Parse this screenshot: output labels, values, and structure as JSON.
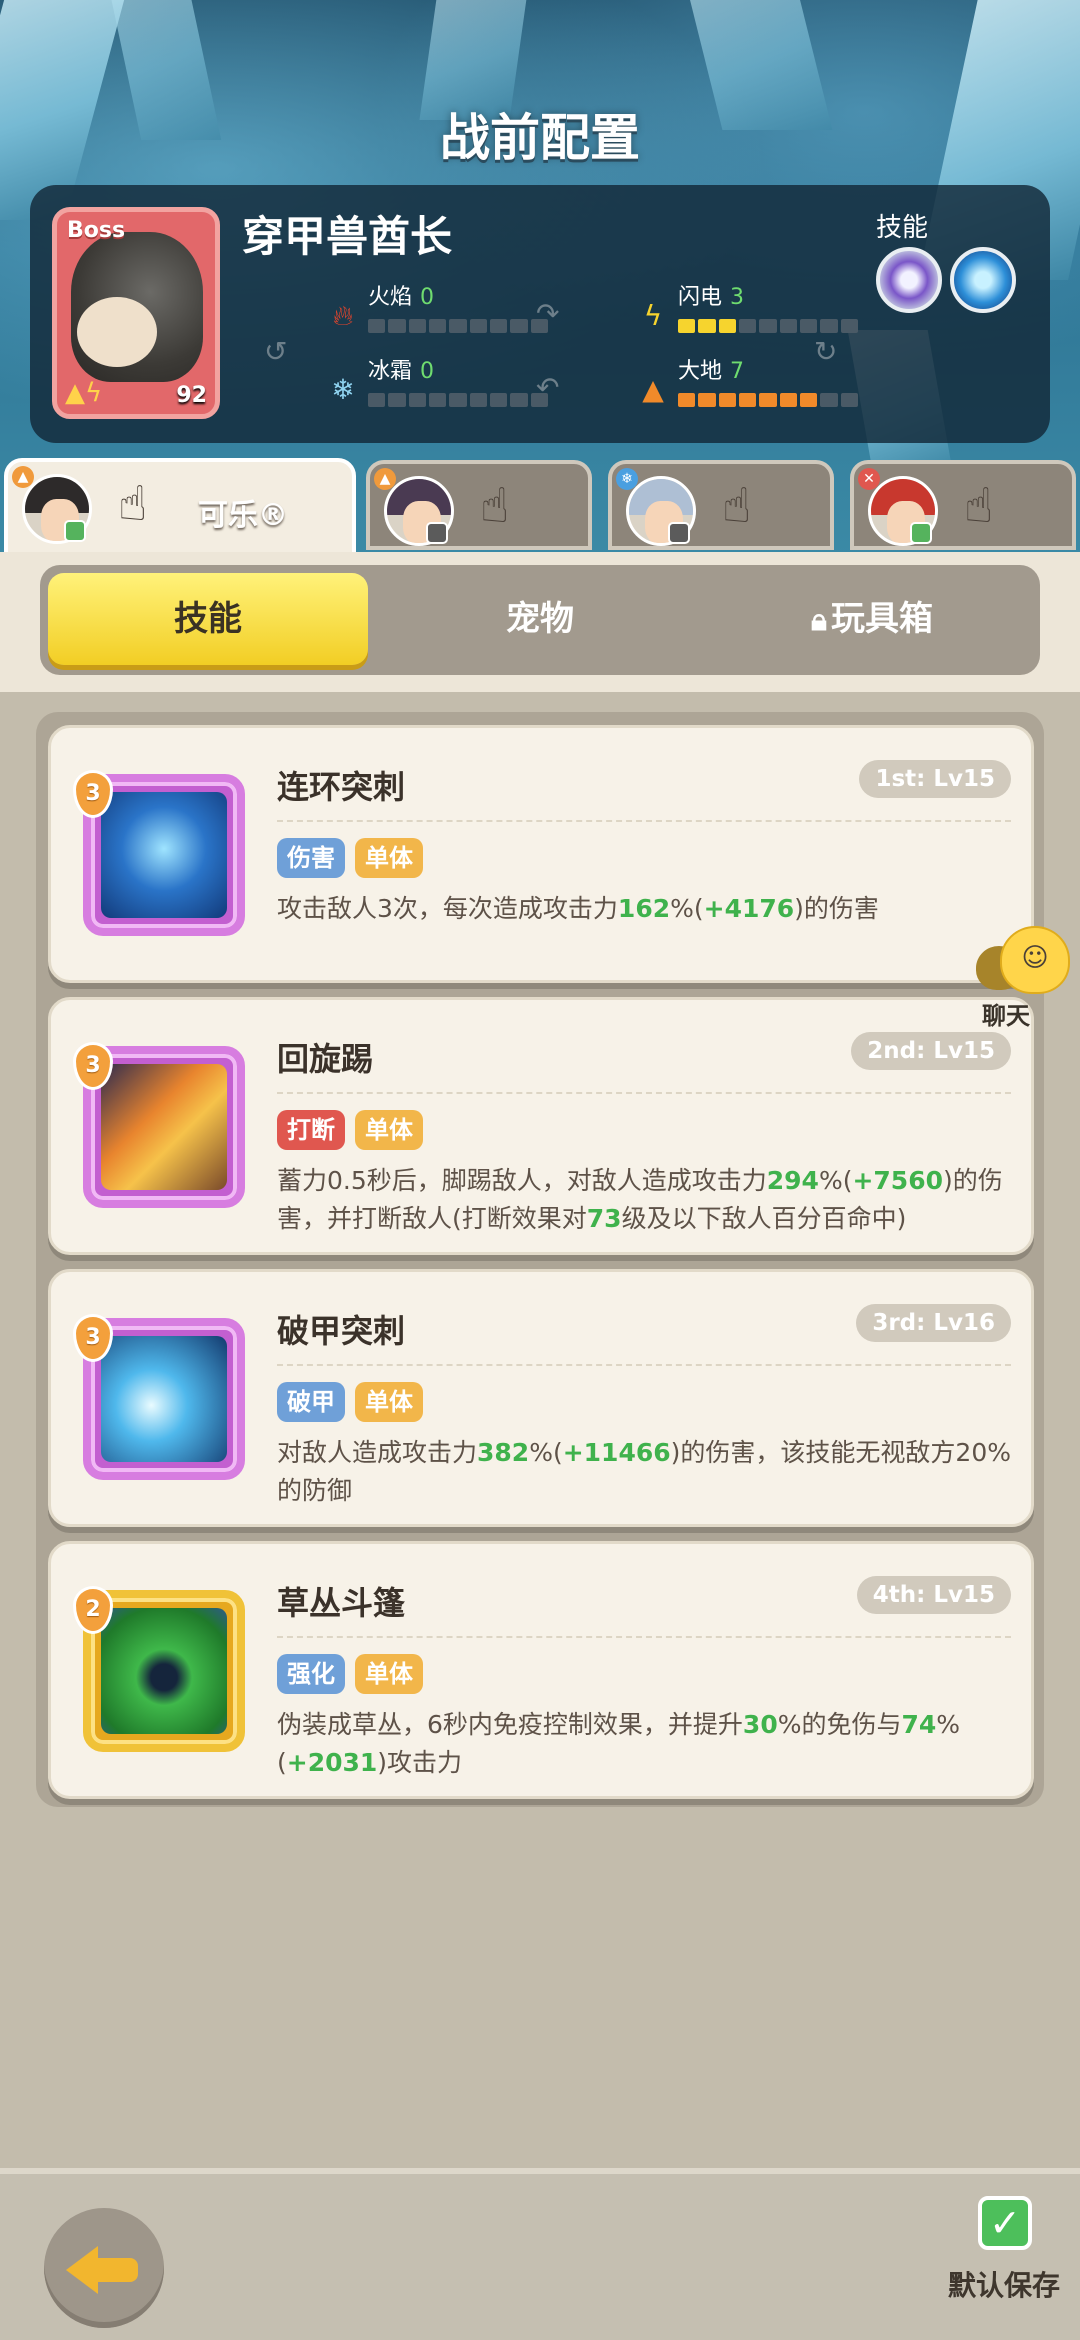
{
  "header": {
    "title": "战前配置"
  },
  "boss": {
    "tag": "Boss",
    "level": "92",
    "name": "穿甲兽酋长",
    "stats": [
      {
        "label": "火焰",
        "value": "0",
        "filled": 0,
        "total": 9,
        "color": "#f08a2a"
      },
      {
        "label": "闪电",
        "value": "3",
        "filled": 3,
        "total": 9,
        "color": "#f6d42e"
      },
      {
        "label": "冰霜",
        "value": "0",
        "filled": 0,
        "total": 9,
        "color": "#8fd3f0"
      },
      {
        "label": "大地",
        "value": "7",
        "filled": 7,
        "total": 9,
        "color": "#f08a2a"
      }
    ],
    "skills_label": "技能"
  },
  "heroes": [
    {
      "name": "可乐",
      "active": true
    },
    {
      "name": "",
      "active": false
    },
    {
      "name": "",
      "active": false
    },
    {
      "name": "",
      "active": false
    }
  ],
  "tabs": {
    "skills": "技能",
    "pets": "宠物",
    "toybox": "玩具箱"
  },
  "skills": [
    {
      "level": "3",
      "title": "连环突刺",
      "rank": "1st: Lv15",
      "tags": [
        "伤害",
        "单体"
      ],
      "desc_parts": [
        "攻击敌人3次，每次造成攻击力",
        "162",
        "%(",
        "+4176",
        ")的伤害"
      ]
    },
    {
      "level": "3",
      "title": "回旋踢",
      "rank": "2nd: Lv15",
      "tags": [
        "打断",
        "单体"
      ],
      "desc_parts": [
        "蓄力0.5秒后，脚踢敌人，对敌人造成攻击力",
        "294",
        "%(",
        "+7560",
        ")的伤害，并打断敌人(打断效果对",
        "73",
        "级及以下敌人百分百命中)"
      ]
    },
    {
      "level": "3",
      "title": "破甲突刺",
      "rank": "3rd: Lv16",
      "tags": [
        "破甲",
        "单体"
      ],
      "desc_parts": [
        "对敌人造成攻击力",
        "382",
        "%(",
        "+11466",
        ")的伤害，该技能无视敌方20%的防御"
      ]
    },
    {
      "level": "2",
      "title": "草丛斗篷",
      "rank": "4th: Lv15",
      "tags": [
        "强化",
        "单体"
      ],
      "desc_parts": [
        "伪装成草丛，6秒内免疫控制效果，并提升",
        "30",
        "%的免伤与",
        "74",
        "%(",
        "+2031",
        ")攻击力"
      ]
    }
  ],
  "chat": {
    "label": "聊天"
  },
  "footer": {
    "save_label": "默认保存"
  }
}
